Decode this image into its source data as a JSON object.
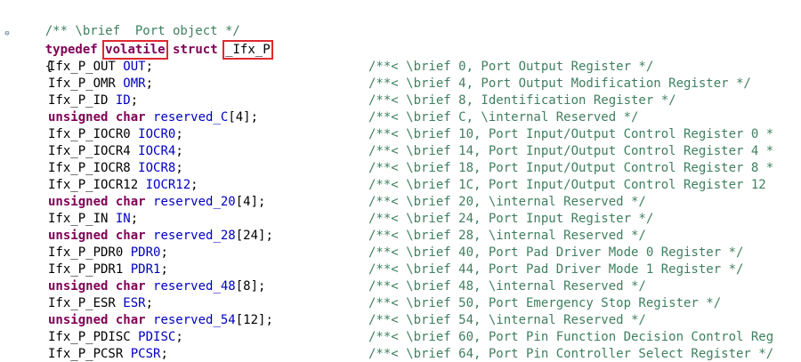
{
  "header": {
    "doc_comment": "/** \\brief  Port object */",
    "kw_typedef": "typedef",
    "kw_volatile": "volatile",
    "kw_struct": "struct",
    "struct_name": "_Ifx_P",
    "open_brace": "{"
  },
  "members": [
    {
      "keyword": "",
      "type": "Ifx_P_OUT",
      "name": "OUT",
      "suffix": ";",
      "comment": "/**< \\brief 0, Port Output Register */"
    },
    {
      "keyword": "",
      "type": "Ifx_P_OMR",
      "name": "OMR",
      "suffix": ";",
      "comment": "/**< \\brief 4, Port Output Modification Register */"
    },
    {
      "keyword": "",
      "type": "Ifx_P_ID",
      "name": "ID",
      "suffix": ";",
      "comment": "/**< \\brief 8, Identification Register */"
    },
    {
      "keyword": "unsigned char",
      "type": "",
      "name": "reserved_C",
      "suffix": "[4];",
      "comment": "/**< \\brief C, \\internal Reserved */"
    },
    {
      "keyword": "",
      "type": "Ifx_P_IOCR0",
      "name": "IOCR0",
      "suffix": ";",
      "comment": "/**< \\brief 10, Port Input/Output Control Register 0 *"
    },
    {
      "keyword": "",
      "type": "Ifx_P_IOCR4",
      "name": "IOCR4",
      "suffix": ";",
      "comment": "/**< \\brief 14, Port Input/Output Control Register 4 *"
    },
    {
      "keyword": "",
      "type": "Ifx_P_IOCR8",
      "name": "IOCR8",
      "suffix": ";",
      "comment": "/**< \\brief 18, Port Input/Output Control Register 8 *"
    },
    {
      "keyword": "",
      "type": "Ifx_P_IOCR12",
      "name": "IOCR12",
      "suffix": ";",
      "comment": "/**< \\brief 1C, Port Input/Output Control Register 12"
    },
    {
      "keyword": "unsigned char",
      "type": "",
      "name": "reserved_20",
      "suffix": "[4];",
      "comment": "/**< \\brief 20, \\internal Reserved */"
    },
    {
      "keyword": "",
      "type": "Ifx_P_IN",
      "name": "IN",
      "suffix": ";",
      "comment": "/**< \\brief 24, Port Input Register */"
    },
    {
      "keyword": "unsigned char",
      "type": "",
      "name": "reserved_28",
      "suffix": "[24];",
      "comment": "/**< \\brief 28, \\internal Reserved */"
    },
    {
      "keyword": "",
      "type": "Ifx_P_PDR0",
      "name": "PDR0",
      "suffix": ";",
      "comment": "/**< \\brief 40, Port Pad Driver Mode 0 Register */"
    },
    {
      "keyword": "",
      "type": "Ifx_P_PDR1",
      "name": "PDR1",
      "suffix": ";",
      "comment": "/**< \\brief 44, Port Pad Driver Mode 1 Register */"
    },
    {
      "keyword": "unsigned char",
      "type": "",
      "name": "reserved_48",
      "suffix": "[8];",
      "comment": "/**< \\brief 48, \\internal Reserved */"
    },
    {
      "keyword": "",
      "type": "Ifx_P_ESR",
      "name": "ESR",
      "suffix": ";",
      "comment": "/**< \\brief 50, Port Emergency Stop Register */"
    },
    {
      "keyword": "unsigned char",
      "type": "",
      "name": "reserved_54",
      "suffix": "[12];",
      "comment": "/**< \\brief 54, \\internal Reserved */"
    },
    {
      "keyword": "",
      "type": "Ifx_P_PDISC",
      "name": "PDISC",
      "suffix": ";",
      "comment": "/**< \\brief 60, Port Pin Function Decision Control Reg"
    },
    {
      "keyword": "",
      "type": "Ifx_P_PCSR",
      "name": "PCSR",
      "suffix": ";",
      "comment": "/**< \\brief 64, Port Pin Controller Select Register */"
    }
  ],
  "colors": {
    "comment": "#3f7f5f",
    "keyword": "#7f0055",
    "field": "#0000c0",
    "highlight_box": "#e0282f"
  },
  "gutter": {
    "fold_icon": "collapse-minus-icon",
    "fold_glyph": "⊖"
  }
}
